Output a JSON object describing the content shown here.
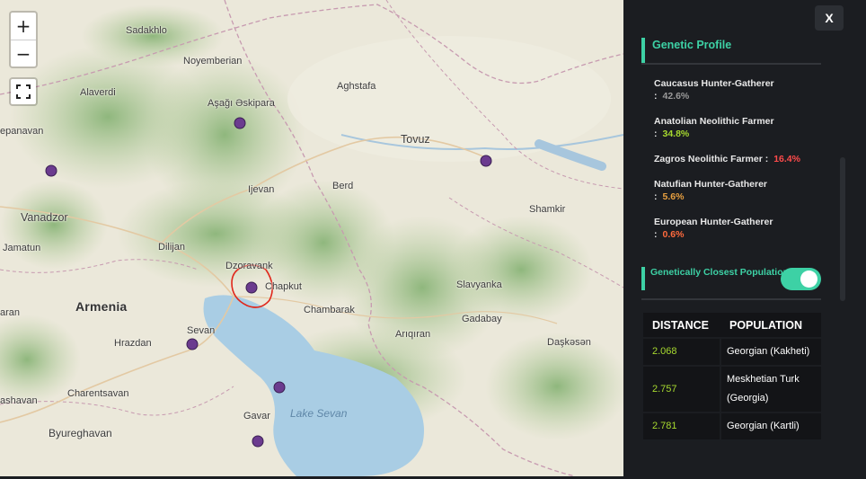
{
  "map": {
    "zoom_in": "+",
    "zoom_out": "−",
    "places": [
      {
        "name": "Sadakhlo",
        "cls": ""
      },
      {
        "name": "Noyemberian",
        "cls": ""
      },
      {
        "name": "Alaverdi",
        "cls": ""
      },
      {
        "name": "Aşağı Əskipara",
        "cls": ""
      },
      {
        "name": "Aghstafa",
        "cls": ""
      },
      {
        "name": "epanavan",
        "cls": ""
      },
      {
        "name": "Tovuz",
        "cls": ""
      },
      {
        "name": "Ijevan",
        "cls": ""
      },
      {
        "name": "Berd",
        "cls": ""
      },
      {
        "name": "Vanadzor",
        "cls": ""
      },
      {
        "name": "Shamkir",
        "cls": ""
      },
      {
        "name": "Jamatun",
        "cls": ""
      },
      {
        "name": "Dilijan",
        "cls": ""
      },
      {
        "name": "Dzoravank",
        "cls": ""
      },
      {
        "name": "Chapkut",
        "cls": ""
      },
      {
        "name": "Slavyanka",
        "cls": ""
      },
      {
        "name": "Armenia",
        "cls": "big"
      },
      {
        "name": "Chambarak",
        "cls": ""
      },
      {
        "name": "Gadabay",
        "cls": ""
      },
      {
        "name": "aran",
        "cls": ""
      },
      {
        "name": "Sevan",
        "cls": ""
      },
      {
        "name": "Arıqıran",
        "cls": ""
      },
      {
        "name": "Hrazdan",
        "cls": ""
      },
      {
        "name": "Daşkəsən",
        "cls": ""
      },
      {
        "name": "Charentsavan",
        "cls": ""
      },
      {
        "name": "ashavan",
        "cls": ""
      },
      {
        "name": "Lake Sevan",
        "cls": "water"
      },
      {
        "name": "Gavar",
        "cls": ""
      },
      {
        "name": "Byureghavan",
        "cls": ""
      }
    ]
  },
  "panel": {
    "close_label": "X",
    "section_title": "Genetic Profile",
    "profile": [
      {
        "name": "Caucasus Hunter-Gatherer",
        "pct": "42.6%",
        "color": "#9a9a9a"
      },
      {
        "name": "Anatolian Neolithic Farmer",
        "pct": "34.8%",
        "color": "#a6d82f"
      },
      {
        "name": "Zagros Neolithic Farmer",
        "pct": "16.4%",
        "color": "#ff4b4b"
      },
      {
        "name": "Natufian Hunter-Gatherer",
        "pct": "5.6%",
        "color": "#e8a040"
      },
      {
        "name": "European Hunter-Gatherer",
        "pct": "0.6%",
        "color": "#ff6a3d"
      }
    ],
    "closest_label": "Genetically Closest Populations",
    "toggle_on": true,
    "table": {
      "headers": [
        "DISTANCE",
        "POPULATION"
      ],
      "rows": [
        {
          "distance": "2.068",
          "population": "Georgian (Kakheti)"
        },
        {
          "distance": "2.757",
          "population": "Meskhetian Turk (Georgia)"
        },
        {
          "distance": "2.781",
          "population": "Georgian (Kartli)"
        }
      ]
    },
    "colors": {
      "accent": "#3dd1a5",
      "background": "#1b1d21"
    }
  }
}
